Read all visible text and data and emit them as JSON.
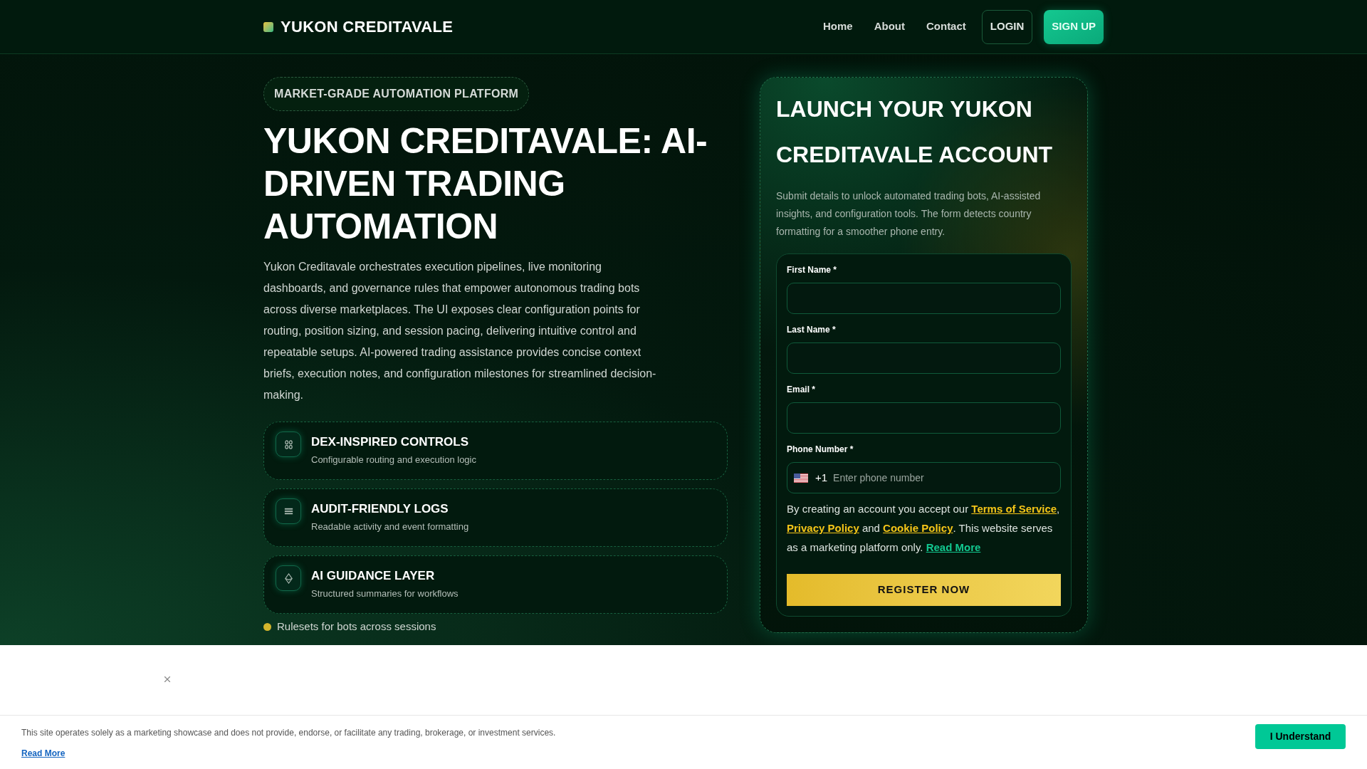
{
  "header": {
    "brand": "YUKON CREDITAVALE",
    "nav": [
      {
        "label": "Home"
      },
      {
        "label": "About"
      },
      {
        "label": "Contact"
      }
    ],
    "actions": [
      {
        "kind": "outline",
        "label": "LOGIN"
      },
      {
        "kind": "filled",
        "label": "SIGN UP"
      }
    ]
  },
  "hero": {
    "badge": "MARKET-GRADE AUTOMATION PLATFORM",
    "title": "YUKON CREDITAVALE: AI-DRIVEN TRADING AUTOMATION",
    "description": "Yukon Creditavale orchestrates execution pipelines, live monitoring dashboards, and governance rules that empower autonomous trading bots across diverse marketplaces. The UI exposes clear configuration points for routing, position sizing, and session pacing, delivering intuitive control and repeatable setups. AI-powered trading assistance provides concise context briefs, execution notes, and configuration milestones for streamlined decision-making.",
    "features": [
      {
        "title": "DEX-INSPIRED CONTROLS",
        "subtitle": "Configurable routing and execution logic"
      },
      {
        "title": "AUDIT-FRIENDLY LOGS",
        "subtitle": "Readable activity and event formatting"
      },
      {
        "title": "AI GUIDANCE LAYER",
        "subtitle": "Structured summaries for workflows"
      }
    ],
    "bullets": [
      "Rulesets for bots across sessions"
    ]
  },
  "signup": {
    "title": "LAUNCH YOUR YUKON CREDITAVALE ACCOUNT",
    "description": "Submit details to unlock automated trading bots, AI-assisted insights, and configuration tools. The form detects country formatting for a smoother phone entry.",
    "fields": [
      {
        "kind": "text",
        "label": "First Name *"
      },
      {
        "kind": "text",
        "label": "Last Name *"
      },
      {
        "kind": "text",
        "label": "Email *"
      },
      {
        "kind": "phone",
        "label": "Phone Number *",
        "country_code": "+1",
        "placeholder": "Enter phone number"
      }
    ],
    "consent": [
      {
        "kind": "text",
        "text": "By creating an account you accept our "
      },
      {
        "kind": "legal_link",
        "text": "Terms of Service"
      },
      {
        "kind": "text",
        "text": ", "
      },
      {
        "kind": "legal_link",
        "text": "Privacy Policy"
      },
      {
        "kind": "text",
        "text": " and "
      },
      {
        "kind": "legal_link",
        "text": "Cookie Policy"
      },
      {
        "kind": "text",
        "text": ". This website serves as a marketing platform only. "
      },
      {
        "kind": "more_link",
        "text": "Read More"
      }
    ],
    "submit": "REGISTER NOW"
  },
  "cookie_notice": {
    "text": "This site operates solely as a marketing showcase and does not provide, endorse, or facilitate any trading, brokerage, or investment services.",
    "link": "Read More",
    "button": "I Understand"
  }
}
